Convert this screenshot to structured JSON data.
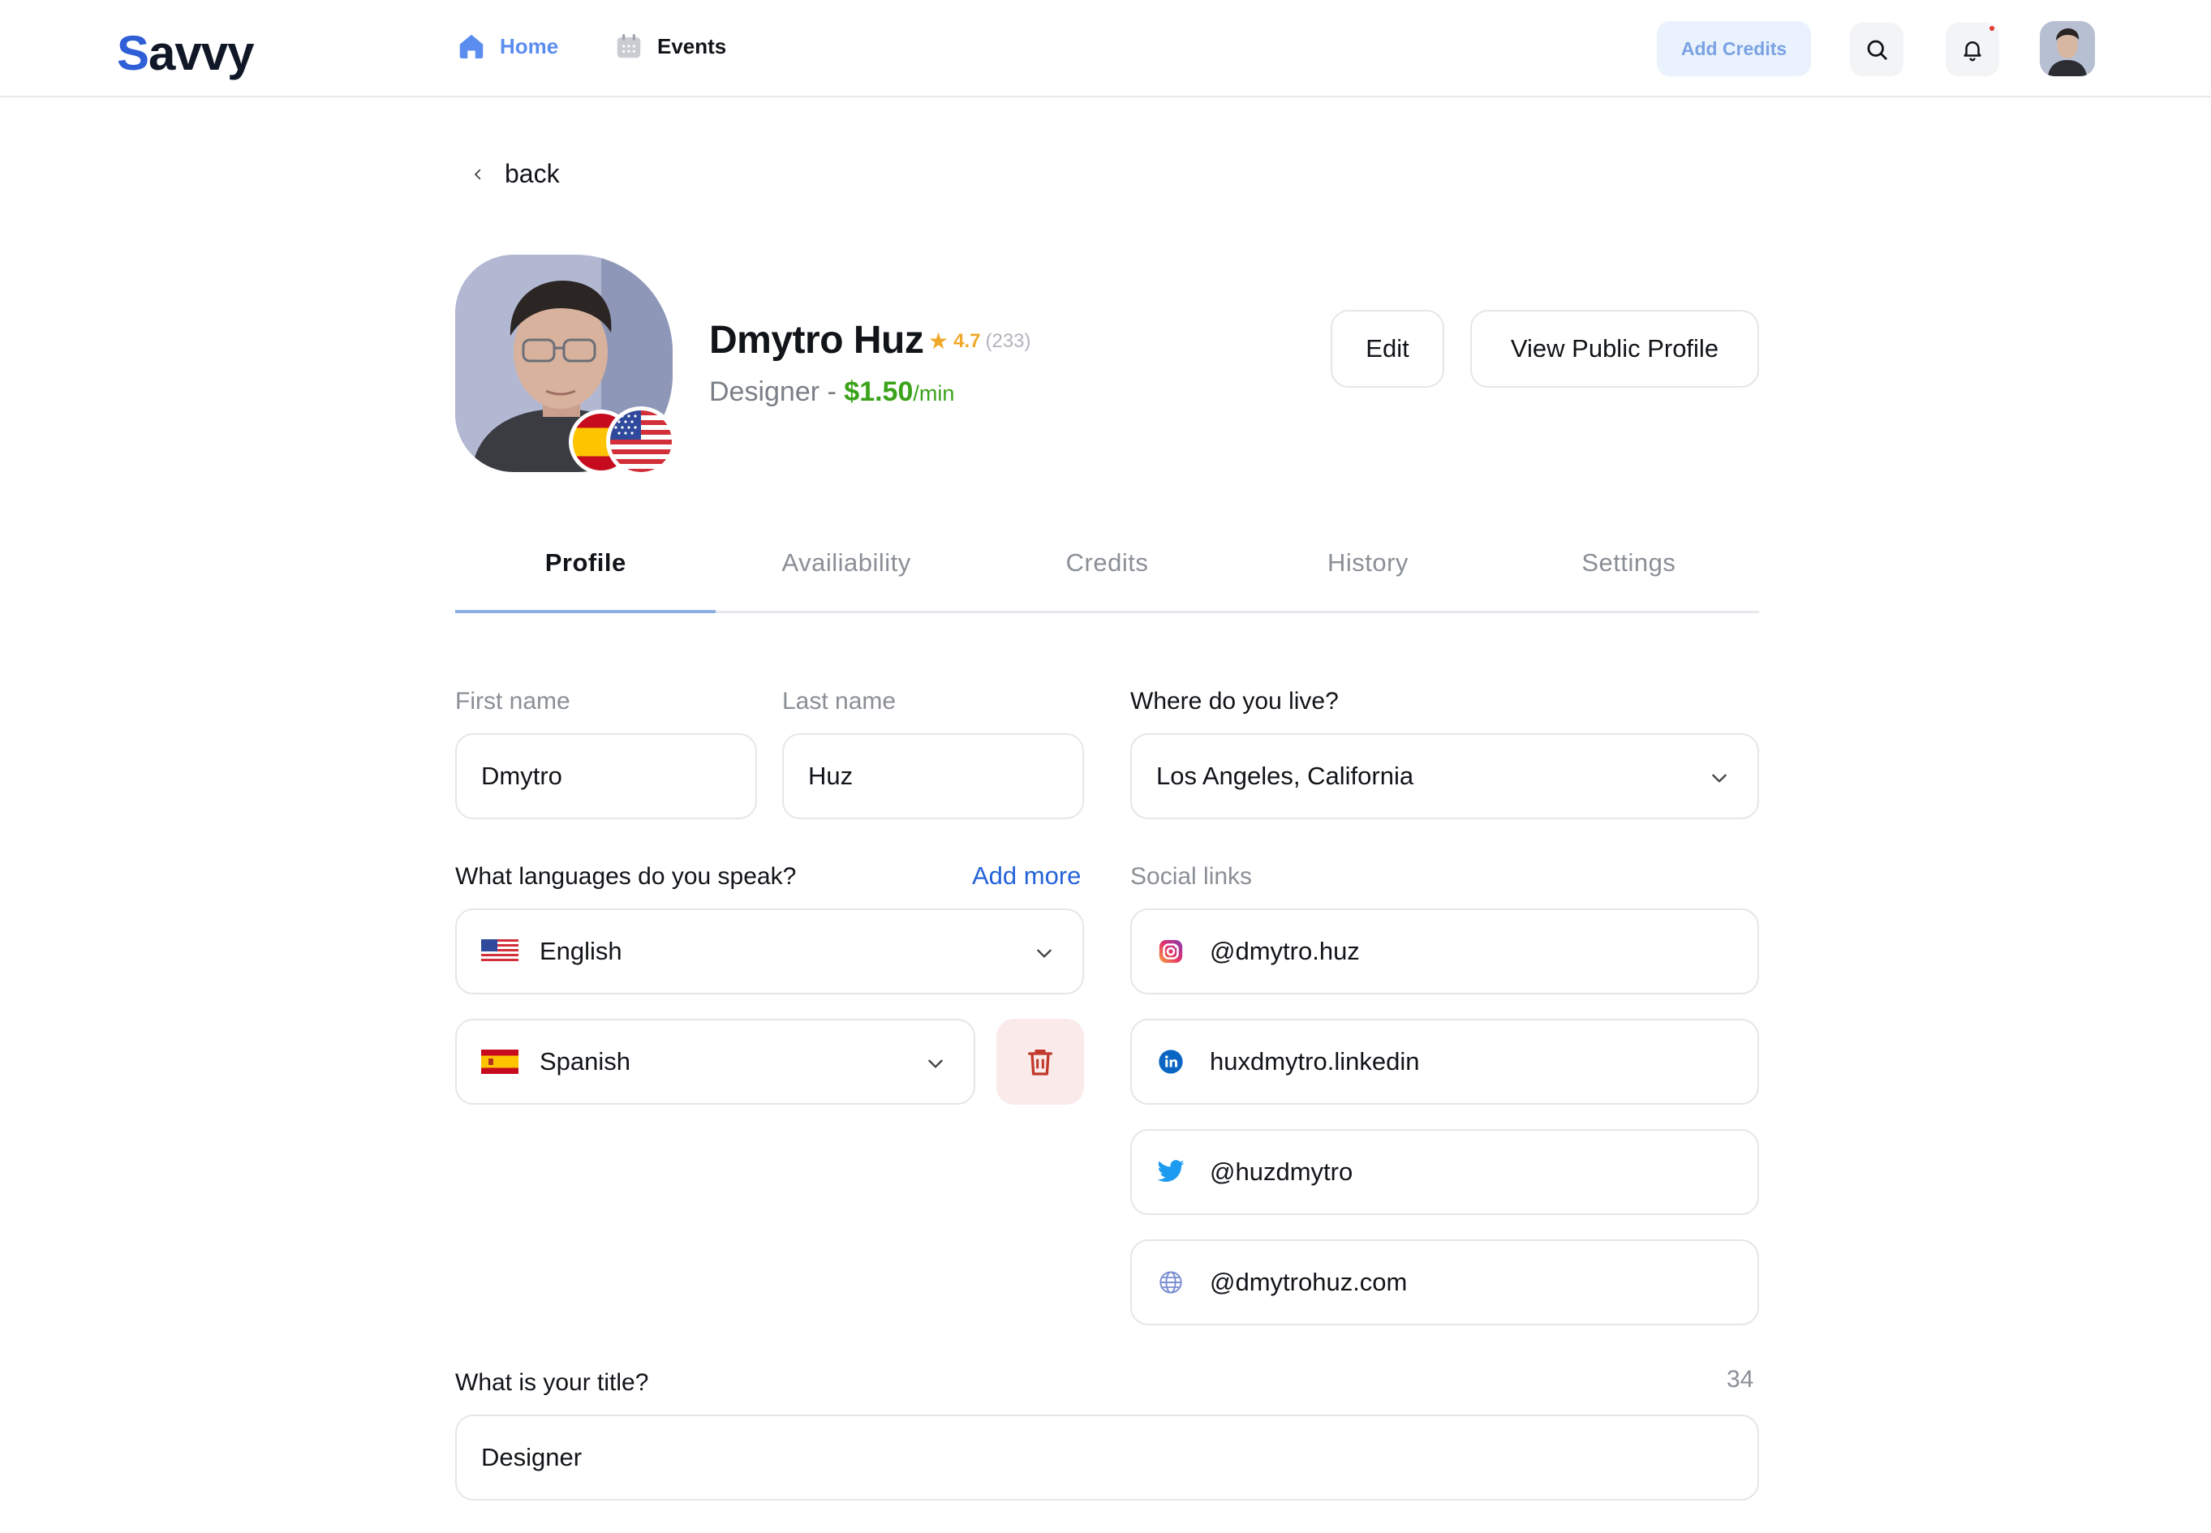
{
  "navbar": {
    "logo_first": "S",
    "logo_rest": "avvy",
    "home_label": "Home",
    "events_label": "Events",
    "add_credits_label": "Add Credits"
  },
  "back_label": "back",
  "profile": {
    "name": "Dmytro Huz",
    "rating": "4.7",
    "rating_count": "(233)",
    "role": "Designer - ",
    "price": "$1.50",
    "price_unit": "/min",
    "edit_label": "Edit",
    "view_public_label": "View Public Profile"
  },
  "tabs": [
    "Profile",
    "Availiability",
    "Credits",
    "History",
    "Settings"
  ],
  "active_tab": "Profile",
  "form": {
    "first_name_label": "First name",
    "first_name_value": "Dmytro",
    "last_name_label": "Last name",
    "last_name_value": "Huz",
    "location_label": "Where do you live?",
    "location_value": "Los Angeles, California",
    "languages_label": "What languages do you speak?",
    "add_more_label": "Add more",
    "languages": [
      "English",
      "Spanish"
    ],
    "social_label": "Social links",
    "social_links": {
      "instagram": "@dmytro.huz",
      "linkedin": "huxdmytro.linkedin",
      "twitter": "@huzdmytro",
      "website": "@dmytrohuz.com"
    },
    "title_label": "What is your title?",
    "title_counter": "34",
    "title_value": "Designer"
  },
  "colors": {
    "accent_blue": "#5b8def",
    "price_green": "#3aa31a",
    "star_orange": "#f0a92a",
    "link_blue": "#2563d9",
    "delete_red": "#c0392b"
  },
  "icons": [
    "home-icon",
    "calendar-icon",
    "search-icon",
    "bell-icon",
    "chevron-left-icon",
    "star-icon",
    "chevron-down-icon",
    "trash-icon",
    "instagram-icon",
    "linkedin-icon",
    "twitter-icon",
    "globe-icon"
  ]
}
